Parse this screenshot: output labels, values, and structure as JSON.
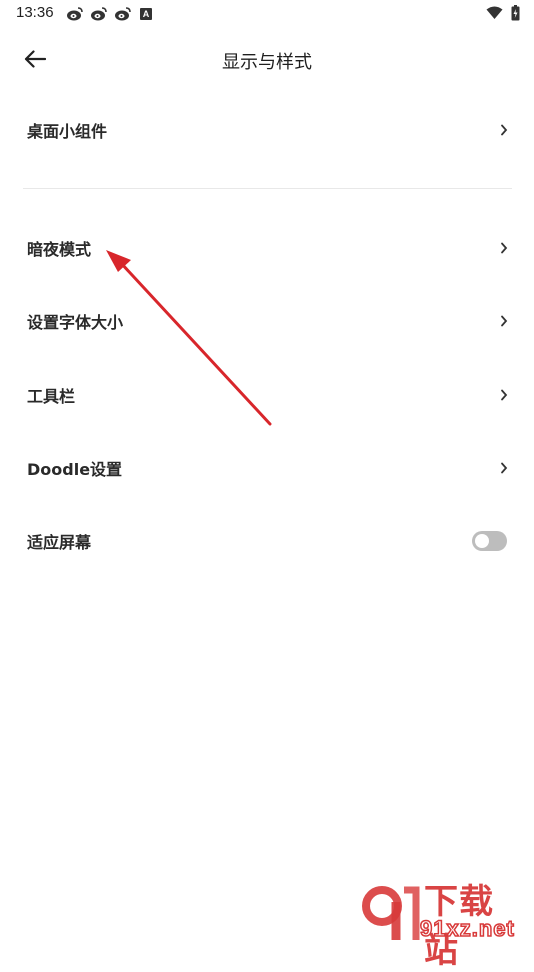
{
  "status_bar": {
    "time": "13:36",
    "badge": "A",
    "icons": [
      "weibo-icon",
      "weibo-icon",
      "weibo-icon",
      "a-badge-icon",
      "wifi-icon",
      "battery-charging-icon"
    ]
  },
  "header": {
    "title": "显示与样式",
    "back_icon": "arrow-left-icon"
  },
  "settings": {
    "widgets": "桌面小组件",
    "dark_mode": "暗夜模式",
    "font_size": "设置字体大小",
    "toolbar": "工具栏",
    "doodle": "Doodle设置",
    "fit_screen": "适应屏幕",
    "fit_screen_enabled": false
  },
  "watermark": {
    "top": "下载站",
    "bottom": "91xz.net"
  },
  "colors": {
    "arrow": "#d8262b",
    "toggle_off": "#bdbdbd",
    "watermark": "#d83a3a"
  }
}
